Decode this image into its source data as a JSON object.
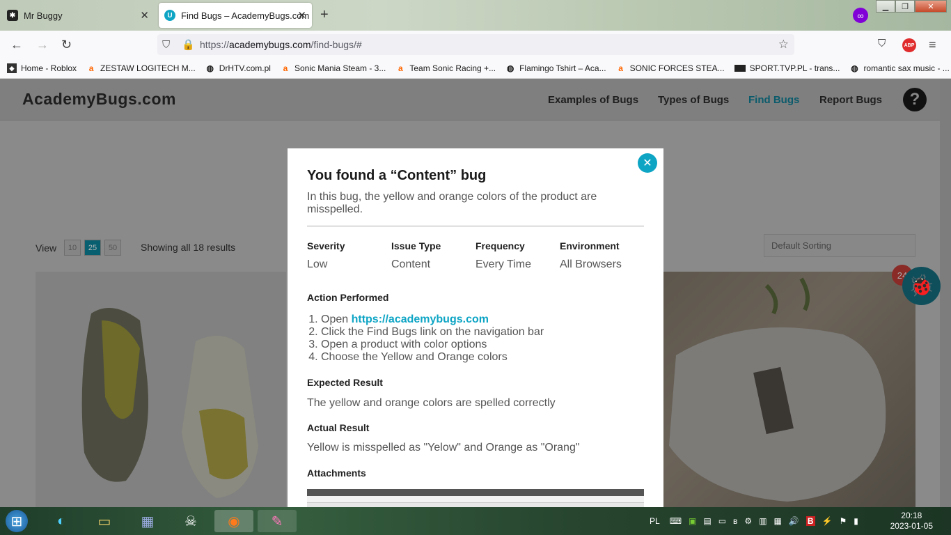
{
  "browser": {
    "tabs": [
      {
        "title": "Mr Buggy",
        "active": false
      },
      {
        "title": "Find Bugs – AcademyBugs.com",
        "active": true
      }
    ],
    "url_prefix": "https://",
    "url_domain": "academybugs.com",
    "url_path": "/find-bugs/#",
    "bookmarks": [
      "Home - Roblox",
      "ZESTAW LOGITECH M...",
      "DrHTV.com.pl",
      "Sonic Mania Steam - 3...",
      "Team Sonic Racing +...",
      "Flamingo Tshirt – Aca...",
      "SONIC FORCES STEA...",
      "SPORT.TVP.PL - trans...",
      "romantic sax music - ..."
    ],
    "extension_label": "ABP"
  },
  "site": {
    "logo": "AcademyBugs.com",
    "nav": [
      "Examples of Bugs",
      "Types of Bugs",
      "Find Bugs",
      "Report Bugs"
    ],
    "active_nav": "Find Bugs",
    "view_label": "View",
    "view_options": [
      "10",
      "25",
      "50"
    ],
    "view_selected": "25",
    "showing": "Showing all 18 results",
    "sort_placeholder": "Default Sorting",
    "bug_count": "24"
  },
  "modal": {
    "title": "You found a “Content” bug",
    "description": "In this bug, the yellow and orange colors of the product are misspelled.",
    "fields": [
      {
        "label": "Severity",
        "value": "Low"
      },
      {
        "label": "Issue Type",
        "value": "Content"
      },
      {
        "label": "Frequency",
        "value": "Every Time"
      },
      {
        "label": "Environment",
        "value": "All Browsers"
      }
    ],
    "action_heading": "Action Performed",
    "steps": [
      "Open ",
      "Click the Find Bugs link on the navigation bar",
      "Open a product with color options",
      "Choose the Yellow and Orange colors"
    ],
    "step_link": "https://academybugs.com",
    "expected_heading": "Expected Result",
    "expected": "The yellow and orange colors are spelled correctly",
    "actual_heading": "Actual Result",
    "actual": "Yellow is misspelled as \"Yelow\" and Orange as \"Orang\"",
    "attachments_heading": "Attachments"
  },
  "taskbar": {
    "lang": "PL",
    "time": "20:18",
    "date": "2023-01-05"
  },
  "colors": {
    "accent": "#0ea5c5",
    "private": "#8000d7"
  }
}
